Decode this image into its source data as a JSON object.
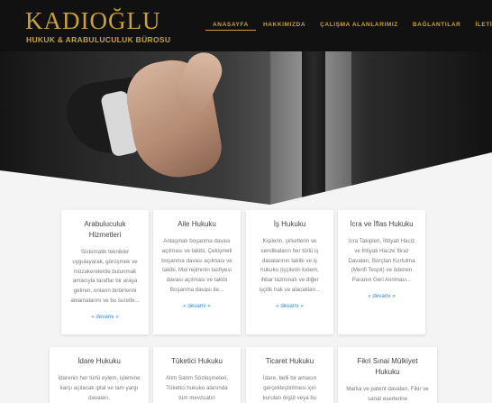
{
  "brand": {
    "title": "KADIOĞLU",
    "subtitle": "HUKUK & ARABULUCULUK BÜROSU"
  },
  "nav": {
    "items": [
      {
        "label": "ANASAYFA"
      },
      {
        "label": "HAKKIMIZDA"
      },
      {
        "label": "ÇALIŞMA ALANLARIMIZ"
      },
      {
        "label": "BAĞLANTILAR"
      },
      {
        "label": "İLETİŞİM"
      }
    ],
    "active": "ANASAYFA"
  },
  "cards": [
    {
      "title": "Arabuluculuk Hizmetleri",
      "text": "Sistematik teknikler uygulayarak, görüşmek ve müzakerelerde bulunmak amacıyla taraflar bir araya getiren, onların birbirlerini anlamalarını ve bu suretle...",
      "more": "« devamı »"
    },
    {
      "title": "Aile Hukuku",
      "text": "Anlaşmalı boşanma davası açılması ve takibi, Çekişmeli boşanma davası açılması ve takibi, Mal rejiminin tasfiyesi davası açılması ve takibi Boşanma davası ile...",
      "more": "« devamı »"
    },
    {
      "title": "İş Hukuku",
      "text": "Kişilerin, şirketlerin ve sendikaların her türlü iş davalarının takibi ve iş hukuku (işçilerin kıdem, ihbar tazminatı ve diğer işçilik hak ve alacakları...",
      "more": "« devamı »"
    },
    {
      "title": "İcra ve İflas Hukuku",
      "text": "İcra Takipleri, İhtiyati Haciz ve İhtiyati Hacze İtiraz Davaları, Borçtan Kurtulma (Menfi Tespit) ve ödenen Paranın Geri Alınması...",
      "more": "« devamı »"
    },
    {
      "title": "İdare Hukuku",
      "text": "İdarenin her türlü eylem, işlemine karşı açılacak iptal ve tam yargı davaları,",
      "more": ""
    },
    {
      "title": "Tüketici Hukuku",
      "text": "Alım Satım Sözleşmeleri, Tüketici hukuku alanında tüm mevzuatın",
      "more": ""
    },
    {
      "title": "Ticaret Hukuku",
      "text": "İdare, belli bir amacın gerçekleştirilmesi için kurulan örgüt veya bu",
      "more": ""
    },
    {
      "title": "Fikri Sınai Mülkiyet Hukuku",
      "text": "Marka ve patent davaları, Fikir ve sanat eserlerine",
      "more": ""
    }
  ]
}
